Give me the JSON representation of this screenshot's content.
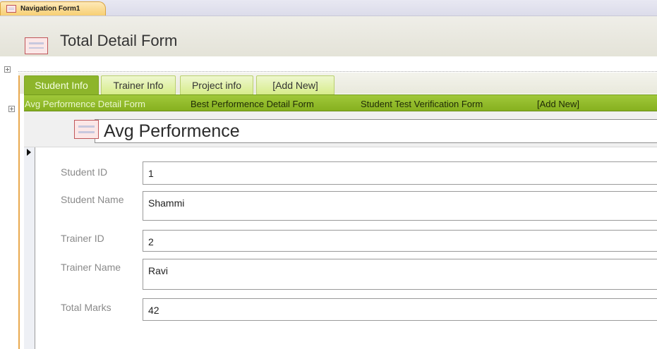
{
  "window": {
    "tab_label": "Navigation Form1",
    "icon": "form-icon"
  },
  "header": {
    "title": "Total Detail Form",
    "icon": "form-icon"
  },
  "nav": {
    "top_tabs": [
      {
        "label": "Student Info",
        "active": true
      },
      {
        "label": "Trainer Info",
        "active": false
      },
      {
        "label": "Project info",
        "active": false
      },
      {
        "label": "[Add New]",
        "active": false
      }
    ],
    "sub_tabs": [
      {
        "label": "Avg Performence Detail Form",
        "active": true
      },
      {
        "label": "Best Performence Detail Form",
        "active": false
      },
      {
        "label": "Student Test Verification Form",
        "active": false
      },
      {
        "label": "[Add New]",
        "active": false
      }
    ]
  },
  "subform": {
    "title": "Avg Performence",
    "icon": "form-icon",
    "fields": [
      {
        "label": "Student ID",
        "value": "1"
      },
      {
        "label": "Student Name",
        "value": "Shammi"
      },
      {
        "label": "Trainer ID",
        "value": "2"
      },
      {
        "label": "Trainer Name",
        "value": "Ravi"
      },
      {
        "label": "Total Marks",
        "value": "42"
      }
    ]
  },
  "colors": {
    "active_tab": "#8db52b",
    "inactive_tab": "#dcefa0",
    "sub_bar": "#93bb2c",
    "document_tab": "#f7cf73"
  }
}
